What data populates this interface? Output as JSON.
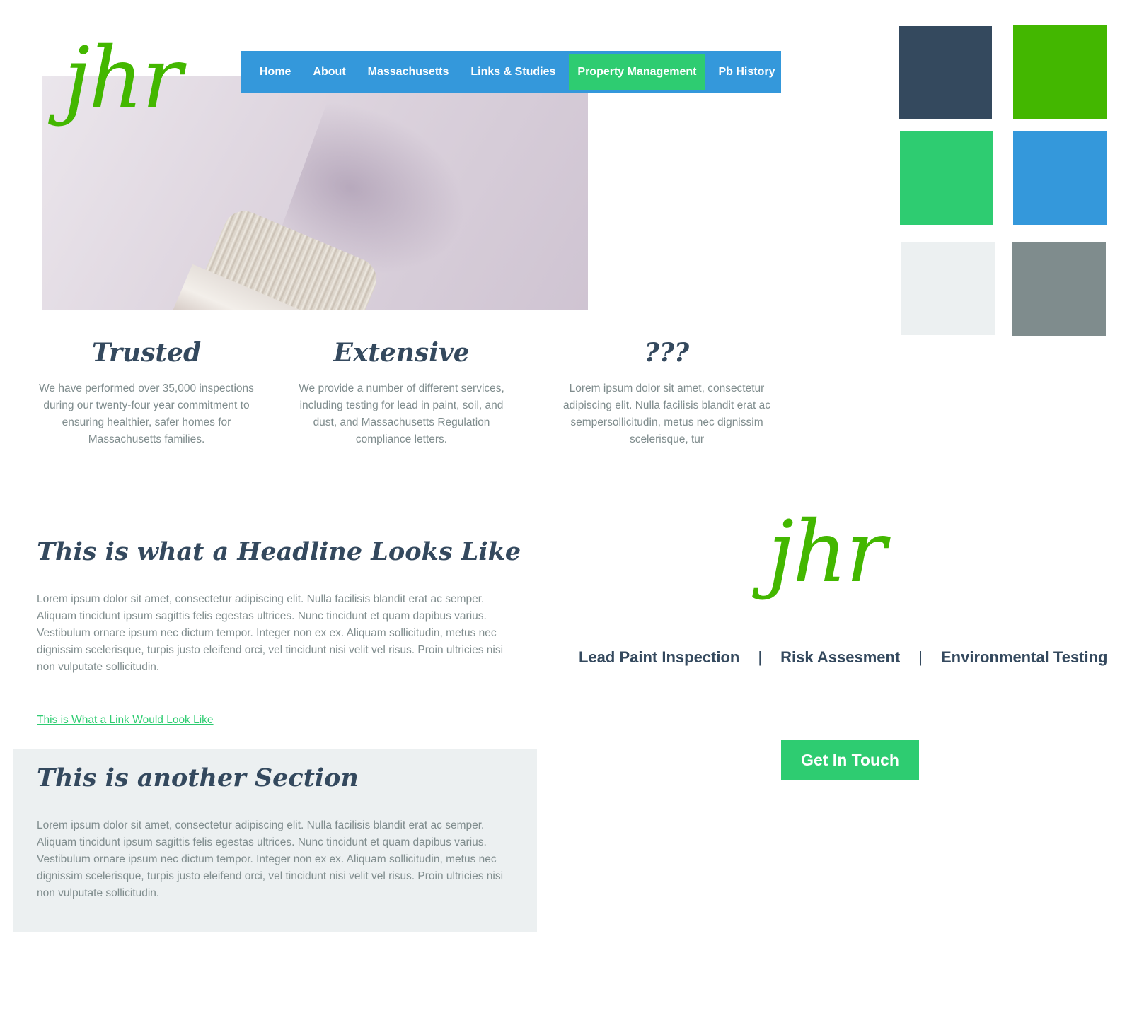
{
  "logo": {
    "text": "jhr",
    "color": "#43b700"
  },
  "nav": {
    "background": "#3498db",
    "items": [
      {
        "label": "Home"
      },
      {
        "label": "About"
      },
      {
        "label": "Massachusetts"
      },
      {
        "label": "Links & Studies"
      },
      {
        "label": "Property Management",
        "active": true
      },
      {
        "label": "Pb History"
      }
    ]
  },
  "palette": [
    "#34495e",
    "#43b700",
    "#2ecc71",
    "#3498db",
    "#ecf0f1",
    "#7f8c8d"
  ],
  "features": [
    {
      "title": "Trusted",
      "text": "We have performed over 35,000 inspections during our twenty-four year commitment to ensuring healthier, safer homes for Massachusetts families."
    },
    {
      "title": "Extensive",
      "text": "We provide a number of different services, including testing for lead in paint, soil, and dust, and Massachusetts Regulation compliance letters."
    },
    {
      "title": "???",
      "text": "Lorem ipsum dolor sit amet, consectetur adipiscing elit. Nulla facilisis blandit erat ac sempersollicitudin, metus nec dignissim scelerisque, tur"
    }
  ],
  "section1": {
    "headline": "This is what a Headline Looks Like",
    "body": "Lorem ipsum dolor sit amet, consectetur adipiscing elit. Nulla facilisis blandit erat ac semper. Aliquam tincidunt ipsum sagittis felis egestas ultrices. Nunc tincidunt et quam dapibus varius. Vestibulum ornare ipsum nec dictum tempor. Integer non ex ex. Aliquam sollicitudin, metus nec dignissim scelerisque, turpis justo eleifend orci, vel tincidunt nisi velit vel risus. Proin ultricies nisi non vulputate sollicitudin.",
    "link": "This is What a Link Would Look Like"
  },
  "section2": {
    "headline": "This is another Section",
    "body": "Lorem ipsum dolor sit amet, consectetur adipiscing elit. Nulla facilisis blandit erat ac semper. Aliquam tincidunt ipsum sagittis felis egestas ultrices. Nunc tincidunt et quam dapibus varius. Vestibulum ornare ipsum nec dictum tempor. Integer non ex ex. Aliquam sollicitudin, metus nec dignissim scelerisque, turpis justo eleifend orci, vel tincidunt nisi velit vel risus. Proin ultricies nisi non vulputate sollicitudin."
  },
  "services": [
    "Lead Paint Inspection",
    "Risk Assesment",
    "Environmental Testing"
  ],
  "service_separator": "|",
  "cta": {
    "label": "Get In Touch"
  }
}
